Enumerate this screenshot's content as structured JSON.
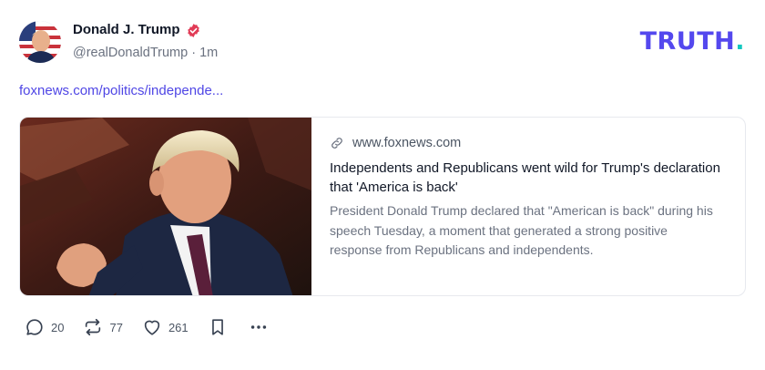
{
  "brand": {
    "name": "TRUTH",
    "suffix": ".",
    "color": "#5448ee",
    "accent": "#14c8c0"
  },
  "post": {
    "author": {
      "name": "Donald J. Trump",
      "handle": "@realDonaldTrump",
      "separator": "·",
      "time": "1m",
      "verified": true,
      "verified_color": "#e13b56"
    },
    "link_text": "foxnews.com/politics/independe...",
    "card": {
      "domain": "www.foxnews.com",
      "title": "Independents and Republicans went wild for Trump's declaration that 'America is back'",
      "description": "President Donald Trump declared that \"American is back\" during his speech Tuesday, a moment that generated a strong positive response from Republicans and independents."
    },
    "actions": {
      "replies": "20",
      "retruths": "77",
      "likes": "261"
    }
  },
  "icons": {
    "verified": "verified-badge-icon",
    "link": "link-icon",
    "reply": "reply-icon",
    "retruth": "retruth-icon",
    "like": "heart-icon",
    "bookmark": "bookmark-icon",
    "more": "more-icon"
  }
}
